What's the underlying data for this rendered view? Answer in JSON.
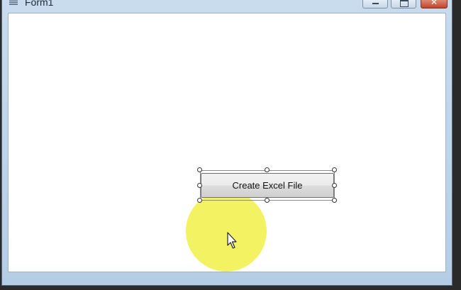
{
  "window": {
    "title": "Form1",
    "close_glyph": "✕"
  },
  "form": {
    "button_label": "Create Excel File"
  },
  "icons": {
    "app": "form-app-icon",
    "cursor": "mouse-pointer-icon"
  },
  "colors": {
    "highlight": "#f1f156",
    "close_button": "#c0442a"
  }
}
